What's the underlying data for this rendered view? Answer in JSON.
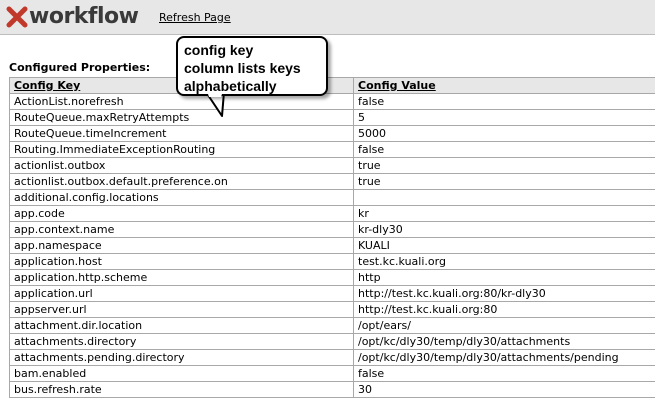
{
  "header": {
    "logo_text": "workflow",
    "refresh_label": "Refresh Page"
  },
  "section_title": "Configured Properties:",
  "table": {
    "columns": [
      "Config Key",
      "Config Value"
    ],
    "rows": [
      [
        "ActionList.norefresh",
        "false"
      ],
      [
        "RouteQueue.maxRetryAttempts",
        "5"
      ],
      [
        "RouteQueue.timeIncrement",
        "5000"
      ],
      [
        "Routing.ImmediateExceptionRouting",
        "false"
      ],
      [
        "actionlist.outbox",
        "true"
      ],
      [
        "actionlist.outbox.default.preference.on",
        "true"
      ],
      [
        "additional.config.locations",
        ""
      ],
      [
        "app.code",
        "kr"
      ],
      [
        "app.context.name",
        "kr-dly30"
      ],
      [
        "app.namespace",
        "KUALI"
      ],
      [
        "application.host",
        "test.kc.kuali.org"
      ],
      [
        "application.http.scheme",
        "http"
      ],
      [
        "application.url",
        "http://test.kc.kuali.org:80/kr-dly30"
      ],
      [
        "appserver.url",
        "http://test.kc.kuali.org:80"
      ],
      [
        "attachment.dir.location",
        "/opt/ears/"
      ],
      [
        "attachments.directory",
        "/opt/kc/dly30/temp/dly30/attachments"
      ],
      [
        "attachments.pending.directory",
        "/opt/kc/dly30/temp/dly30/attachments/pending"
      ],
      [
        "bam.enabled",
        "false"
      ],
      [
        "bus.refresh.rate",
        "30"
      ]
    ]
  },
  "callout": {
    "lines": [
      "config key",
      "column lists keys",
      "alphabetically"
    ]
  },
  "colors": {
    "header_bg": "#e7e7e7",
    "logo_x": "#c0392b",
    "border": "#a8a8a8"
  }
}
